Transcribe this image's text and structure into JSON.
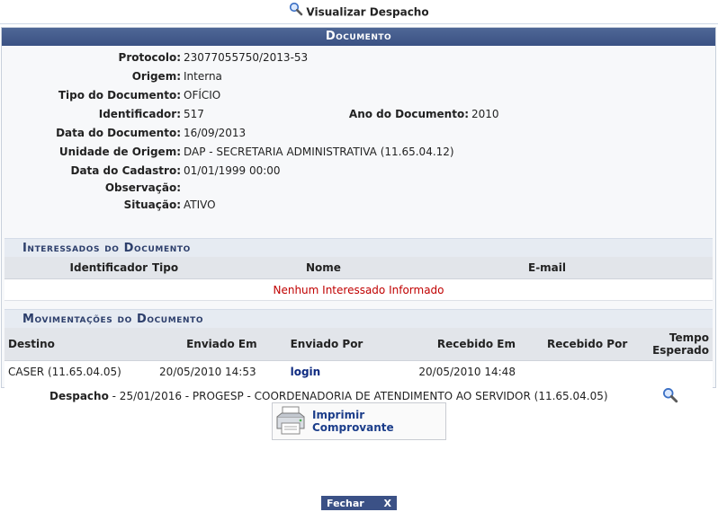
{
  "page": {
    "title": "Visualizar Despacho"
  },
  "documento": {
    "header": "Documento",
    "fields": {
      "protocolo": {
        "label": "Protocolo:",
        "value": "23077055750/2013-53"
      },
      "origem": {
        "label": "Origem:",
        "value": "Interna"
      },
      "tipo": {
        "label": "Tipo do Documento:",
        "value": "OFÍCIO"
      },
      "identificador": {
        "label": "Identificador:",
        "value": "517"
      },
      "ano": {
        "label": "Ano do Documento:",
        "value": "2010"
      },
      "data": {
        "label": "Data do Documento:",
        "value": "16/09/2013"
      },
      "unidade": {
        "label": "Unidade de Origem:",
        "value": "DAP - SECRETARIA ADMINISTRATIVA (11.65.04.12)"
      },
      "cadastro": {
        "label": "Data do Cadastro:",
        "value": "01/01/1999 00:00"
      },
      "observacao": {
        "label": "Observação:",
        "value": ""
      },
      "situacao": {
        "label": "Situação:",
        "value": "ATIVO"
      }
    }
  },
  "interessados": {
    "header": "Interessados do Documento",
    "columns": [
      "Identificador",
      "Tipo",
      "Nome",
      "E-mail"
    ],
    "empty_message": "Nenhum Interessado Informado"
  },
  "movimentacoes": {
    "header": "Movimentações do Documento",
    "columns": {
      "destino": "Destino",
      "enviado_em": "Enviado Em",
      "enviado_por": "Enviado Por",
      "recebido_em": "Recebido Em",
      "recebido_por": "Recebido Por",
      "tempo_line1": "Tempo",
      "tempo_line2": "Esperado"
    },
    "rows": [
      {
        "destino": "CASER (11.65.04.05)",
        "enviado_em": "20/05/2010 14:53",
        "enviado_por": "login",
        "recebido_em": "20/05/2010 14:48",
        "recebido_por": "",
        "tempo": ""
      }
    ],
    "despacho": {
      "label": "Despacho",
      "text": " - 25/01/2016 - PROGESP - COORDENADORIA DE ATENDIMENTO AO SERVIDOR (11.65.04.05)"
    }
  },
  "actions": {
    "print_label": "Imprimir Comprovante",
    "close_label": "Fechar",
    "close_x": "X"
  }
}
